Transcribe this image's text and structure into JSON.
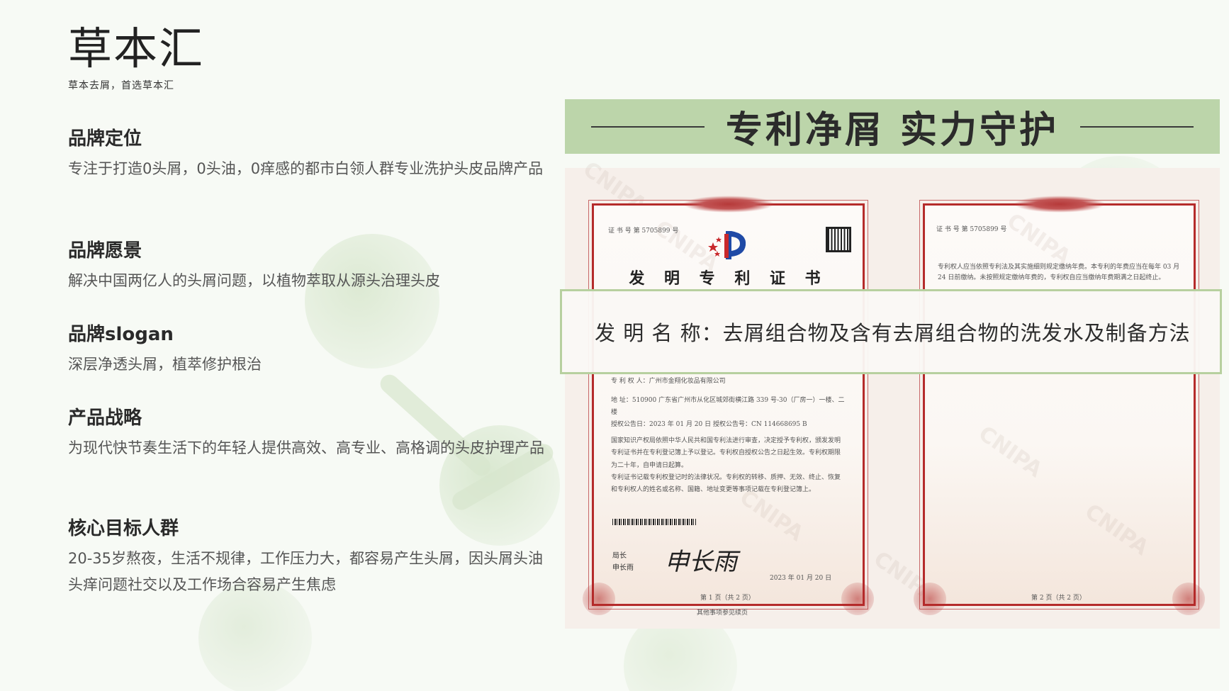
{
  "logo": {
    "name": "草本汇",
    "tagline": "草本去屑，首选草本汇"
  },
  "sections": [
    {
      "heading": "品牌定位",
      "text": "专注于打造0头屑，0头油，0痒感的都市白领人群专业洗护头皮品牌产品"
    },
    {
      "heading": "品牌愿景",
      "text": "解决中国两亿人的头屑问题，以植物萃取从源头治理头皮"
    },
    {
      "heading": "品牌slogan",
      "text": "深层净透头屑，植萃修护根治"
    },
    {
      "heading": "产品战略",
      "text": "为现代快节奏生活下的年轻人提供高效、高专业、高格调的头皮护理产品"
    },
    {
      "heading": "核心目标人群",
      "text": "20-35岁熬夜，生活不规律，工作压力大，都容易产生头屑，因头屑头油头痒问题社交以及工作场合容易产生焦虑"
    }
  ],
  "banner": {
    "title": "专利净屑  实力守护"
  },
  "certificate": {
    "cert_number": "证 书 号 第 5705899 号",
    "cert_number_right": "证 书 号 第 5705899 号",
    "title": "发 明 专 利 证 书",
    "invention_name": "发 明 名 称：去屑组合物及含有去屑组合物的洗发水及制备方法",
    "patentee": "专 利 权 人：广州市金翔化妆品有限公司",
    "address": "地      址：510900 广东省广州市从化区城郊街横江路 339 号-30（厂房一）一楼、二楼",
    "dates": "授权公告日：2023 年 01 月 20 日      授权公告号：CN 114668695 B",
    "body1": "国家知识产权局依照中华人民共和国专利法进行审查，决定授予专利权，颁发发明专利证书并在专利登记簿上予以登记。专利权自授权公告之日起生效。专利权期限为二十年，自申请日起算。",
    "body2": "专利证书记载专利权登记时的法律状况。专利权的转移、质押、无效、终止、恢复和专利权人的姓名或名称、国籍、地址变更等事项记载在专利登记簿上。",
    "director_label": "局长",
    "director_name": "申长雨",
    "signature": "申长雨",
    "issue_date": "2023 年 01 月 20 日",
    "page_left": "第 1 页（共 2 页）",
    "page_note": "其他事项参见续页",
    "page_right": "第 2 页（共 2 页）",
    "right_notice": "专利权人应当依照专利法及其实施细则规定缴纳年费。本专利的年费应当在每年 03 月 24 日前缴纳。未按照规定缴纳年费的，专利权自应当缴纳年费期满之日起终止。",
    "watermark": "CNIPA"
  },
  "colors": {
    "banner": "#bcd5aa",
    "cert_border": "#b52b2b",
    "overlay_border": "#b7d09f"
  }
}
